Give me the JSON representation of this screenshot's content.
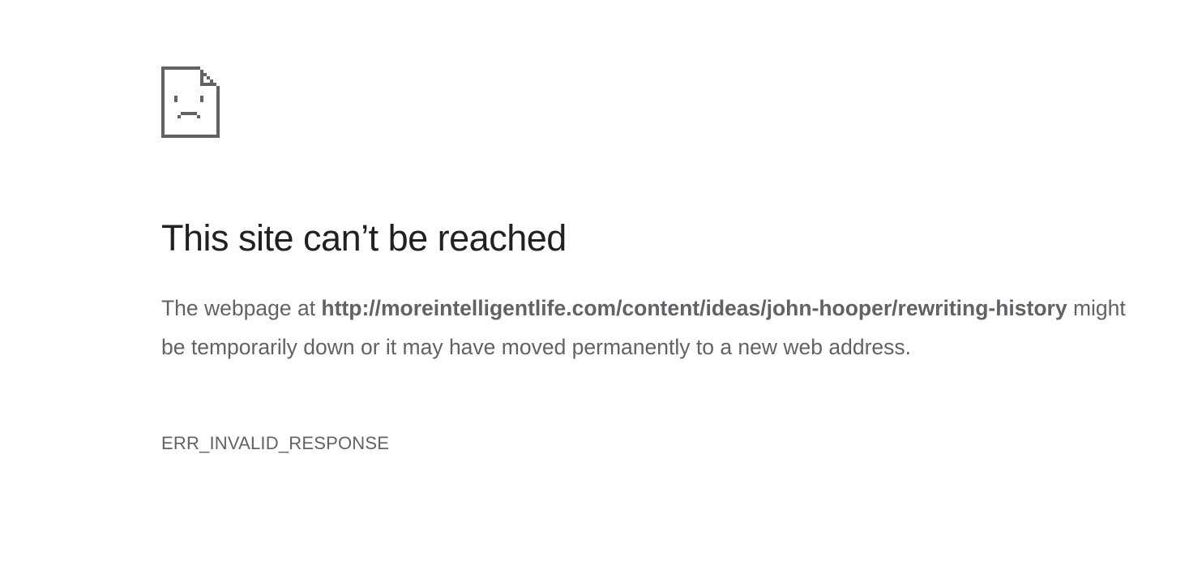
{
  "error_page": {
    "icon": "sad-page-icon",
    "title": "This site can’t be reached",
    "message": {
      "prefix": "The webpage at ",
      "url": "http://moreintelligentlife.com/content/ideas/john-hooper/rewriting-history",
      "suffix": " might be temporarily down or it may have moved permanently to a new web address."
    },
    "error_code": "ERR_INVALID_RESPONSE"
  },
  "colors": {
    "background": "#ffffff",
    "title": "#202124",
    "text": "#5f6368",
    "icon": "#5f6368"
  }
}
